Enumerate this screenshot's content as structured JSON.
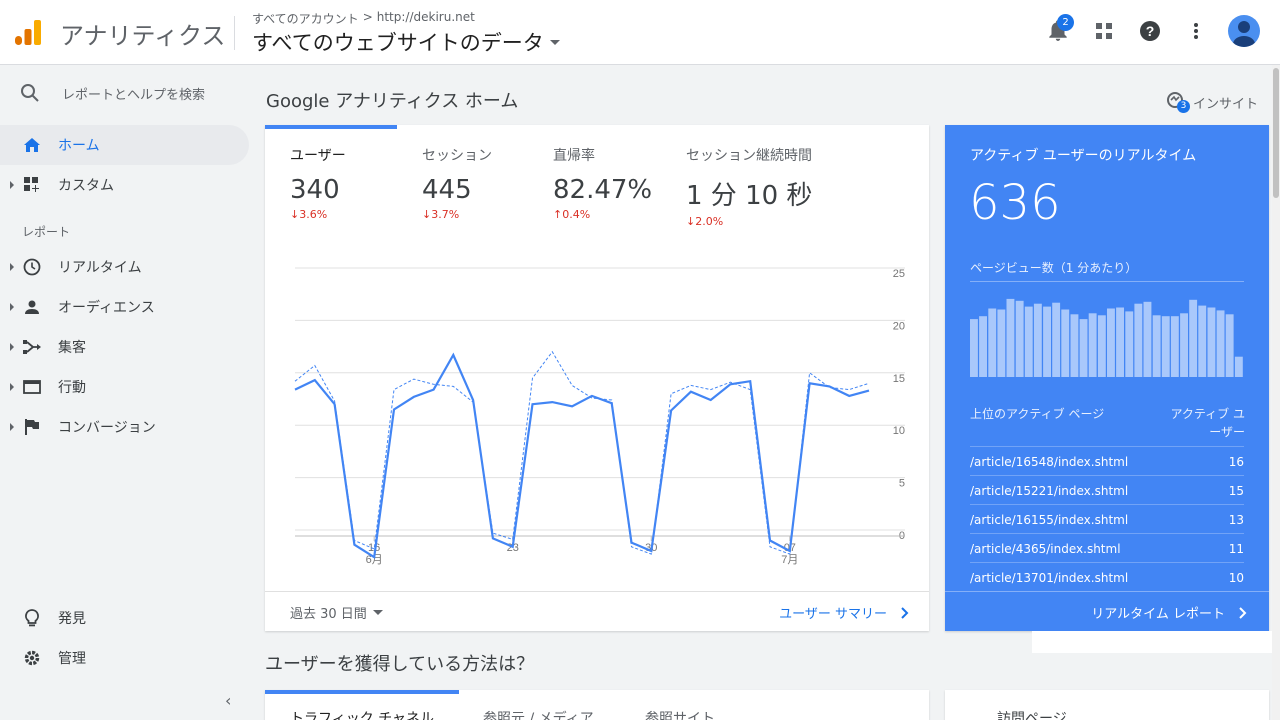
{
  "header": {
    "app_name": "アナリティクス",
    "breadcrumb_account": "すべてのアカウント",
    "breadcrumb_sep": ">",
    "breadcrumb_property": "http://dekiru.net",
    "view_name": "すべてのウェブサイトのデータ",
    "notification_count": "2",
    "icons": [
      "bell-icon",
      "apps-grid-icon",
      "help-icon",
      "more-vert-icon",
      "avatar"
    ]
  },
  "sidebar": {
    "search_placeholder": "レポートとヘルプを検索",
    "top_items": [
      {
        "label": "ホーム",
        "icon": "home-icon",
        "active": true
      },
      {
        "label": "カスタム",
        "icon": "dashboard-icon"
      }
    ],
    "section_label": "レポート",
    "report_items": [
      {
        "label": "リアルタイム",
        "icon": "clock-icon"
      },
      {
        "label": "オーディエンス",
        "icon": "person-icon"
      },
      {
        "label": "集客",
        "icon": "acquisition-icon"
      },
      {
        "label": "行動",
        "icon": "behavior-icon"
      },
      {
        "label": "コンバージョン",
        "icon": "flag-icon"
      }
    ],
    "bottom_items": [
      {
        "label": "発見",
        "icon": "lightbulb-icon"
      },
      {
        "label": "管理",
        "icon": "gear-icon"
      }
    ],
    "collapse_glyph": "‹"
  },
  "main": {
    "title": "Google アナリティクス ホーム",
    "insight_label": "インサイト",
    "insight_count": "3",
    "metrics": [
      {
        "label": "ユーザー",
        "value": "340",
        "change": "↓3.6%"
      },
      {
        "label": "セッション",
        "value": "445",
        "change": "↓3.7%"
      },
      {
        "label": "直帰率",
        "value": "82.47%",
        "change": "↑0.4%"
      },
      {
        "label": "セッション継続時間",
        "value": "1 分 10 秒",
        "change": "↓2.0%"
      }
    ],
    "period": "過去 30 日間",
    "summary_link": "ユーザー サマリー",
    "acquisition_title": "ユーザーを獲得している方法は？",
    "bottom_tabs": [
      "トラフィック チャネル",
      "参照元 / メディア",
      "参照サイト"
    ],
    "bottom_card2_title": "訪問ページ"
  },
  "chart_data": {
    "type": "line",
    "x_labels": [
      {
        "day": "16",
        "month": "6月",
        "index": 4
      },
      {
        "day": "23",
        "month": "",
        "index": 11
      },
      {
        "day": "30",
        "month": "",
        "index": 18
      },
      {
        "day": "07",
        "month": "7月",
        "index": 25
      }
    ],
    "ylim": [
      0,
      25
    ],
    "y_ticks": [
      0,
      5,
      10,
      15,
      20,
      25
    ],
    "series": [
      {
        "style": "solid",
        "values": [
          13.4,
          14.3,
          12,
          -1.4,
          -2.6,
          11.5,
          12.7,
          13.4,
          16.7,
          12.4,
          -0.8,
          -1.6,
          12,
          12.2,
          11.8,
          12.8,
          12.1,
          -1.2,
          -2,
          11.4,
          13.2,
          12.4,
          13.9,
          14.2,
          -1,
          -2,
          14,
          13.7,
          12.8,
          13.3
        ]
      },
      {
        "style": "dashed",
        "values": [
          14.2,
          15.7,
          12.3,
          -1,
          -1.8,
          13.4,
          14.4,
          13.9,
          13.7,
          12.2,
          -0.3,
          -0.9,
          14.5,
          17,
          13.8,
          12.6,
          12.4,
          -1.6,
          -2.3,
          13,
          13.8,
          13.4,
          14.1,
          13.4,
          -1.6,
          -2.3,
          15,
          13.6,
          13.4,
          14
        ]
      }
    ]
  },
  "realtime": {
    "title": "アクティブ ユーザーのリアルタイム",
    "value": "636",
    "pageviews_label": "ページビュー数（1 分あたり）",
    "pageviews": [
      60,
      63,
      71,
      70,
      81,
      79,
      73,
      76,
      73,
      77,
      70,
      65,
      60,
      66,
      64,
      71,
      72,
      68,
      76,
      78,
      64,
      63,
      63,
      66,
      80,
      74,
      72,
      69,
      65,
      21
    ],
    "pageviews_max": 85,
    "table_header_page": "上位のアクティブ ページ",
    "table_header_users": "アクティブ ユーザー",
    "rows": [
      {
        "page": "/article/16548/index.shtml",
        "users": "16"
      },
      {
        "page": "/article/15221/index.shtml",
        "users": "15"
      },
      {
        "page": "/article/16155/index.shtml",
        "users": "13"
      },
      {
        "page": "/article/4365/index.shtml",
        "users": "11"
      },
      {
        "page": "/article/13701/index.shtml",
        "users": "10"
      }
    ],
    "report_link": "リアルタイム レポート"
  },
  "colors": {
    "accent": "#4285f4",
    "link": "#1a73e8",
    "negative": "#d93025"
  }
}
